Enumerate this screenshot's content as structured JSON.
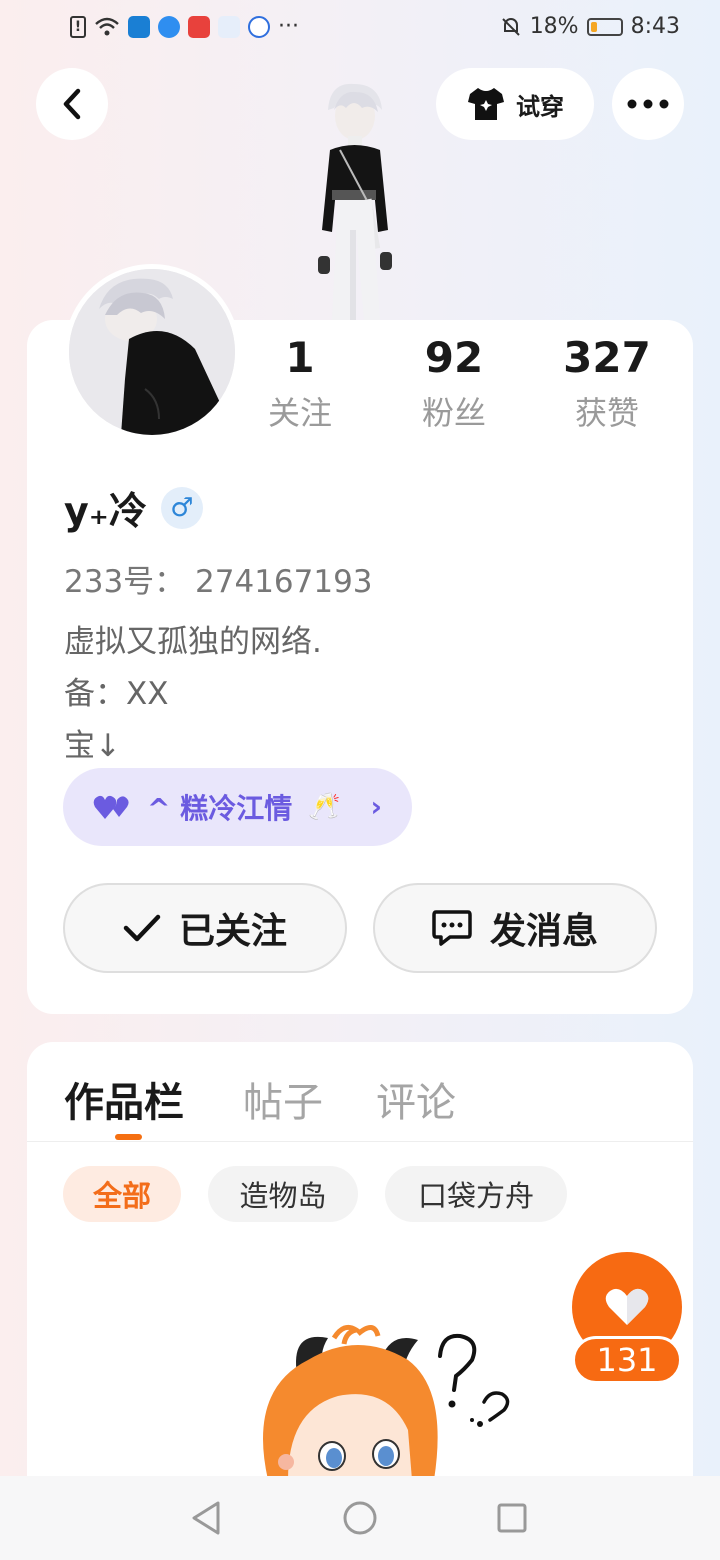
{
  "status_bar": {
    "battery": "18%",
    "time": "8:43",
    "more": "···"
  },
  "header": {
    "try_on_label": "试穿"
  },
  "profile": {
    "name": "y₊冷",
    "gender_symbol": "♂",
    "uid": "233号： 274167193",
    "bio": [
      "虚拟又孤独的网络.",
      "备：XX",
      "宝↓"
    ],
    "group_label": "^ 糕冷江情",
    "group_emoji": "🥂",
    "group_arrow": "›"
  },
  "stats": [
    {
      "value": "1",
      "label": "关注"
    },
    {
      "value": "92",
      "label": "粉丝"
    },
    {
      "value": "327",
      "label": "获赞"
    }
  ],
  "actions": {
    "follow_label": "已关注",
    "message_label": "发消息"
  },
  "tabs": [
    {
      "label": "作品栏"
    },
    {
      "label": "帖子"
    },
    {
      "label": "评论"
    }
  ],
  "filters": [
    {
      "label": "全部"
    },
    {
      "label": "造物岛"
    },
    {
      "label": "口袋方舟"
    }
  ],
  "like": {
    "count": "131"
  },
  "colors": {
    "accent": "#f76a12",
    "group_pill_bg": "#e9e6fb",
    "group_pill_text": "#6b5be0",
    "gender_blue": "#2d86d8"
  }
}
